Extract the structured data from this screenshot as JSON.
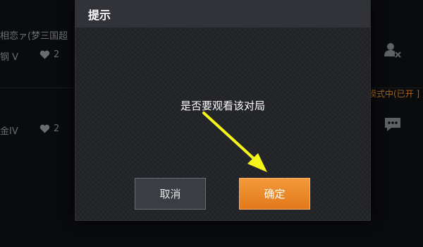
{
  "background_list": [
    {
      "name": "相恋ァ(梦三国超",
      "rank": "钢 V",
      "likes": "2"
    },
    {
      "name": "",
      "rank": "金IV",
      "likes": "2"
    }
  ],
  "side": {
    "mode_text": "模式中(已开 ]"
  },
  "dialog": {
    "title": "提示",
    "message": "是否要观看该对局",
    "cancel_label": "取消",
    "confirm_label": "确定"
  },
  "colors": {
    "confirm_button": "#e8842a",
    "annotation_arrow": "#f5f51a"
  },
  "icons": [
    "heart-icon",
    "user-remove-icon",
    "chat-icon",
    "arrow-annotation"
  ]
}
